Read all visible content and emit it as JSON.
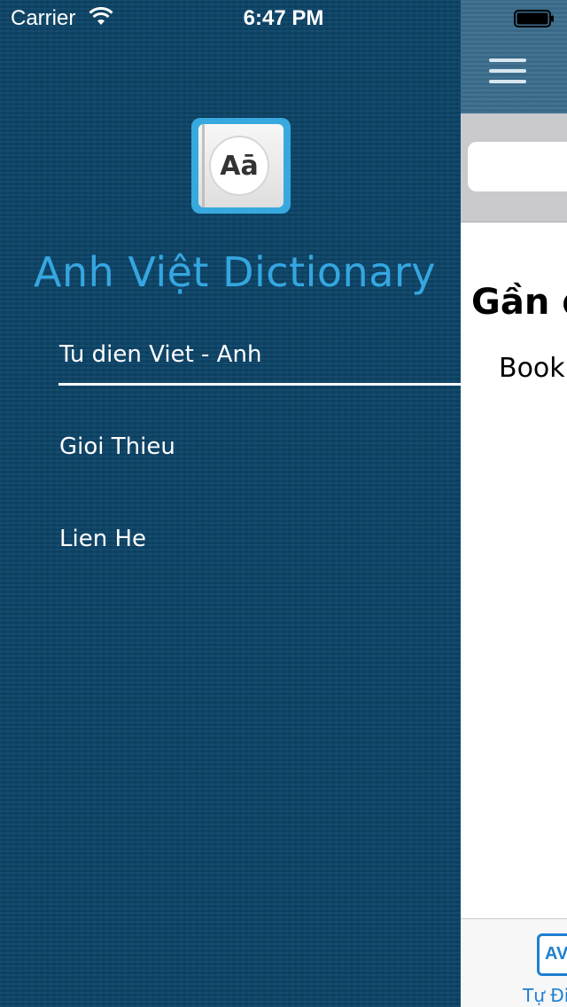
{
  "status_bar": {
    "carrier": "Carrier",
    "time": "6:47 PM",
    "wifi_icon": "wifi-icon",
    "battery_icon": "battery-icon"
  },
  "drawer": {
    "logo": {
      "icon": "dictionary-book-icon",
      "text": "Aā",
      "color": "#38a9df"
    },
    "title": "Anh Việt Dictionary",
    "menu": [
      {
        "label": "Tu dien Viet - Anh",
        "selected": true
      },
      {
        "label": "Gioi Thieu",
        "selected": false
      },
      {
        "label": "Lien He",
        "selected": false
      }
    ]
  },
  "main": {
    "menu_icon": "hamburger-menu-icon",
    "search": {
      "value": "",
      "placeholder": ""
    },
    "recent_heading": "Gần đ",
    "recent_items": [
      "Book"
    ],
    "tab_bar": {
      "tabs": [
        {
          "icon_text": "AV",
          "label": "Tự Đi",
          "active": true
        }
      ]
    }
  },
  "colors": {
    "drawer_bg": "#0c4468",
    "title": "#35a6e0",
    "accent": "#1e7fd0"
  }
}
